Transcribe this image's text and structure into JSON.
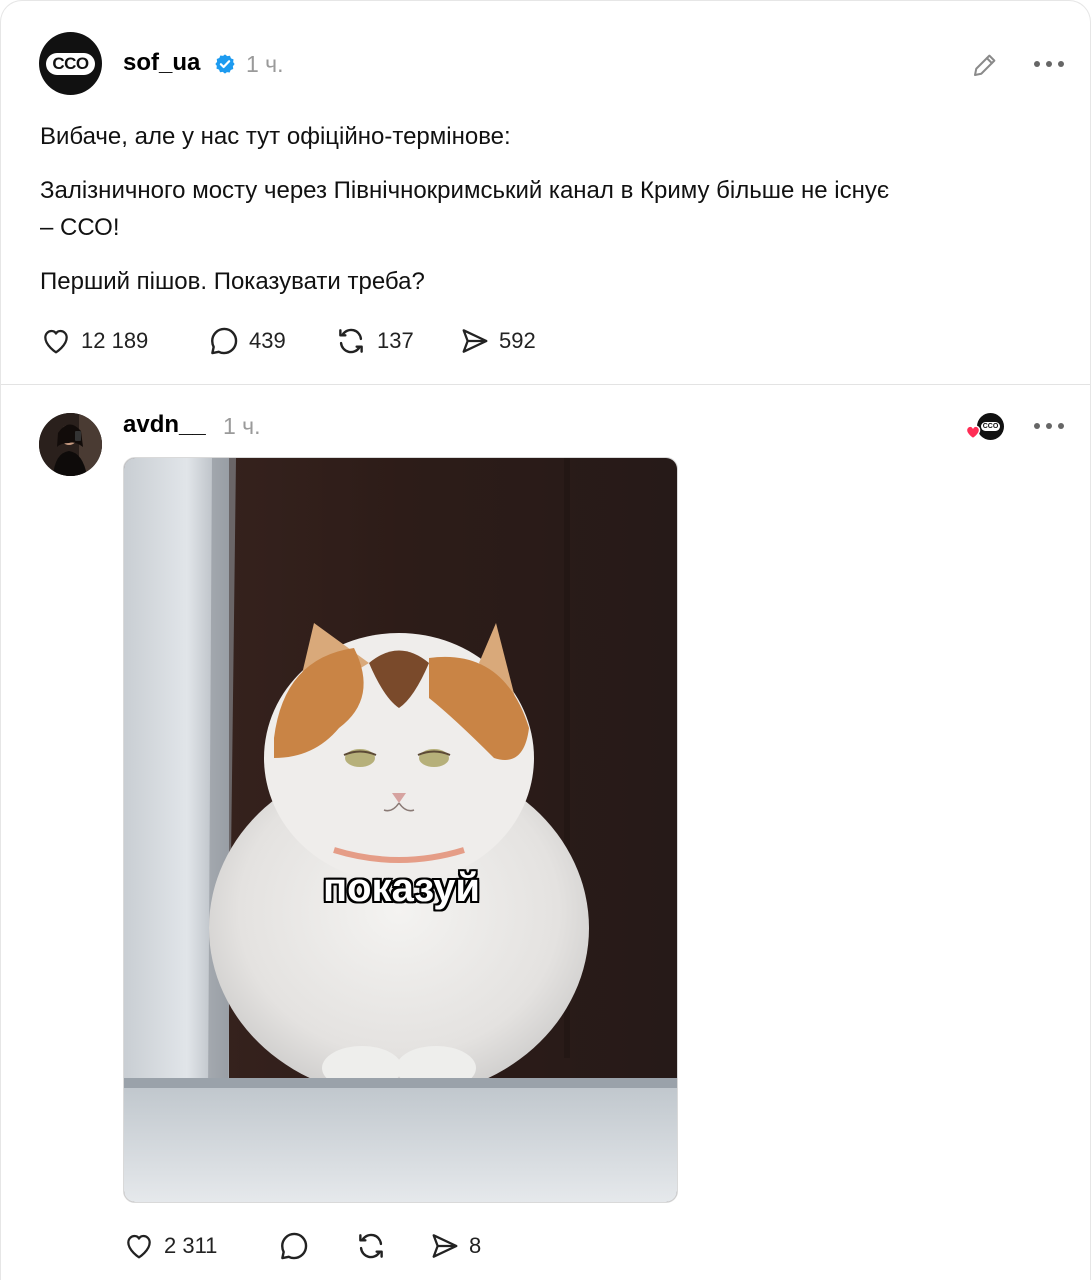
{
  "post1": {
    "avatar_logo": "CCO",
    "username": "sof_ua",
    "verified": true,
    "time": "1 ч.",
    "paragraphs": [
      "Вибаче, але у нас тут офіційно-термінове:",
      "Залізничного мосту через Північнокримський канал в Криму більше не існує",
      "– ССО!",
      "Перший пішов. Показувати треба?"
    ],
    "actions": {
      "likes": "12 189",
      "comments": "439",
      "reposts": "137",
      "shares": "592"
    },
    "icons": [
      "edit-pencil-icon",
      "more-icon",
      "heart-icon",
      "comment-icon",
      "repost-icon",
      "share-icon"
    ]
  },
  "post2": {
    "username": "avdn__",
    "time": "1 ч.",
    "liked_by_avatar_logo": "CCO",
    "media_caption": "показуй",
    "actions": {
      "likes": "2 311",
      "comments": "",
      "reposts": "",
      "shares": "8"
    }
  },
  "colors": {
    "verified_blue": "#1d9bf0",
    "like_red": "#ff2d55",
    "muted": "#9a9a9a"
  }
}
